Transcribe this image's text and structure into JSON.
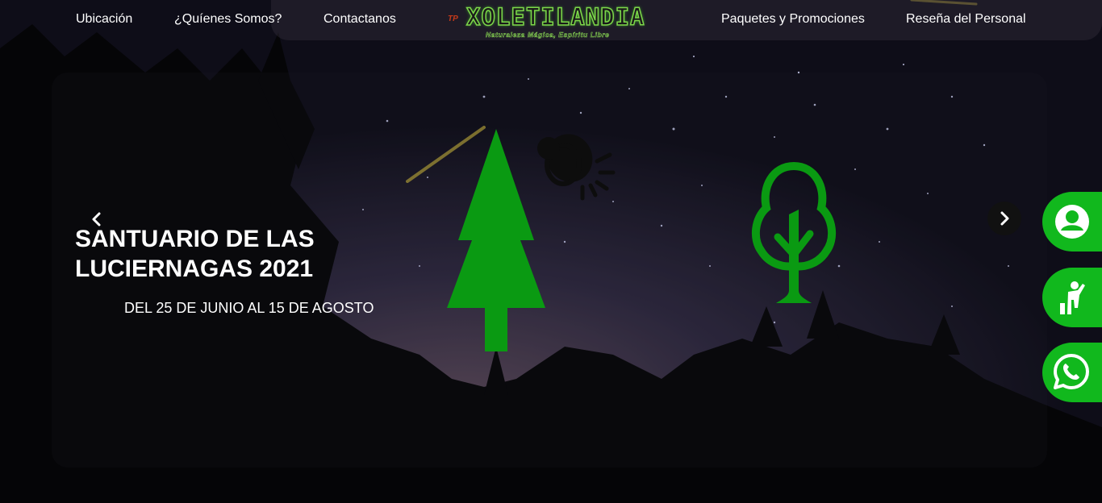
{
  "nav": {
    "left_items": [
      {
        "label": "Ubicación"
      },
      {
        "label": "¿Quíenes Somos?"
      },
      {
        "label": "Contactanos"
      }
    ],
    "right_items": [
      {
        "label": "Paquetes y Promociones"
      },
      {
        "label": "Reseña del Personal"
      }
    ],
    "logo": {
      "name": "Xoletilandia",
      "tagline": "Naturaleza Mágica, Espíritu Libre"
    }
  },
  "slide": {
    "title": "SANTUARIO DE LAS LUCIERNAGAS 2021",
    "subtitle": "DEL 25 DE JUNIO AL 15 DE AGOSTO",
    "prev_icon": "chevron-left-icon",
    "next_icon": "chevron-right-icon"
  },
  "side_buttons": [
    {
      "icon": "user-profile-icon"
    },
    {
      "icon": "person-climbing-icon"
    },
    {
      "icon": "whatsapp-icon"
    }
  ],
  "colors": {
    "accent_green": "#11b81d",
    "decor_green": "#0a9a12",
    "text": "#ffffff"
  }
}
